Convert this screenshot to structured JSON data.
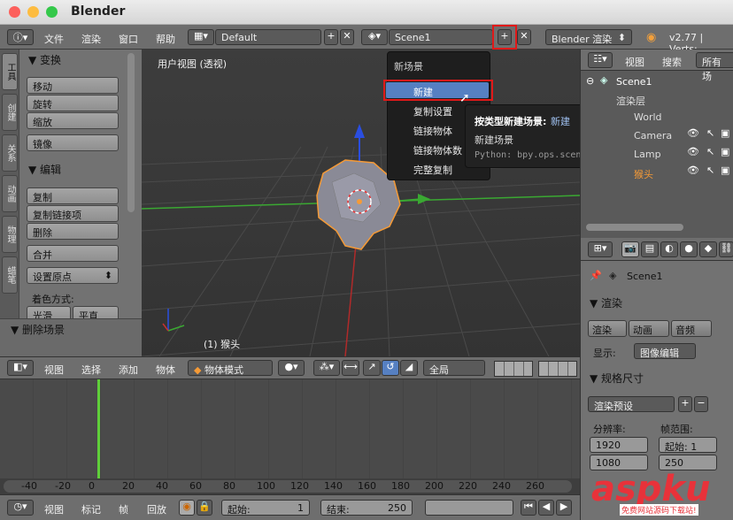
{
  "window": {
    "title": "Blender"
  },
  "topbar": {
    "menus": [
      "文件",
      "渲染",
      "窗口",
      "帮助"
    ],
    "layout": "Default",
    "scene": "Scene1",
    "engine": "Blender 渲染",
    "version": "v2.77 | Verts:"
  },
  "toolshelf": {
    "tabs": [
      "工具",
      "创建",
      "关系",
      "动画",
      "物理",
      "蜡笔"
    ],
    "transform_header": "▼ 变换",
    "transform_buttons": [
      "移动",
      "旋转",
      "缩放",
      "镜像"
    ],
    "edit_header": "▼ 编辑",
    "edit_buttons": [
      "复制",
      "复制链接项",
      "删除",
      "合并"
    ],
    "origin": "设置原点",
    "shading_label": "着色方式:",
    "shading_buttons": [
      "光滑",
      "平直"
    ],
    "delete_scene": "▼ 删除场景"
  },
  "viewport": {
    "label": "用户视图 (透视)",
    "object_label": "(1) 猴头"
  },
  "popup": {
    "title": "新场景",
    "items": [
      "新建",
      "复制设置",
      "链接物体",
      "链接物体数",
      "完整复制"
    ]
  },
  "tooltip": {
    "line1_prefix": "按类型新建场景:",
    "line1_value": "新建",
    "line2": "新建场景",
    "line3": "Python: bpy.ops.scene.new(type='NEW')"
  },
  "outliner": {
    "tabs": [
      "视图",
      "搜索",
      "所有场"
    ],
    "items": [
      "Scene1",
      "渲染层",
      "World",
      "Camera",
      "Lamp",
      "猴头"
    ]
  },
  "properties": {
    "scene": "Scene1",
    "render_header": "▼ 渲染",
    "render_buttons": [
      "渲染",
      "动画",
      "音频"
    ],
    "display_label": "显示:",
    "display_value": "图像编辑",
    "dimensions_header": "▼ 规格尺寸",
    "preset": "渲染预设",
    "resolution_label": "分辨率:",
    "frame_range_label": "帧范围:",
    "res_x": "1920",
    "res_y": "1080",
    "start": "起始: 1",
    "end": "250"
  },
  "viewport_header": {
    "menus": [
      "视图",
      "选择",
      "添加",
      "物体"
    ],
    "mode": "物体模式",
    "pivot": "全局"
  },
  "timeline": {
    "ruler": [
      "-40",
      "-20",
      "0",
      "20",
      "40",
      "60",
      "80",
      "100",
      "120",
      "140",
      "160",
      "180",
      "200",
      "220",
      "240",
      "260"
    ],
    "menus": [
      "视图",
      "标记",
      "帧",
      "回放"
    ],
    "start_label": "起始:",
    "start_value": "1",
    "end_label": "结束:",
    "end_value": "250"
  },
  "watermark": "aspku",
  "watermark_sub": "免费网站源码下载站!",
  "colors": {
    "accent": "#5680c2",
    "highlight_red": "#e01919",
    "selection_orange": "#f59a36"
  }
}
